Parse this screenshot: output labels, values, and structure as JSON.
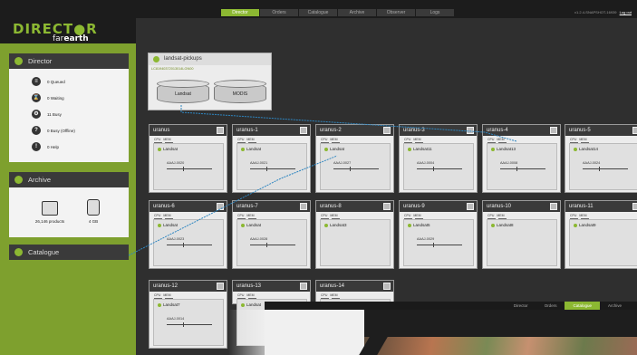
{
  "topnav": {
    "tabs": [
      {
        "label": "Director",
        "active": true
      },
      {
        "label": "Orders",
        "active": false
      },
      {
        "label": "Catalogue",
        "active": false
      },
      {
        "label": "Archive",
        "active": false
      },
      {
        "label": "Observer",
        "active": false
      },
      {
        "label": "Logs",
        "active": false
      }
    ],
    "version": "v1.2.4-SNAPSHOT-16939",
    "logout": "Log out"
  },
  "logo": {
    "title": "DIRECT●R",
    "sub_prefix": "far",
    "sub_bold": "earth"
  },
  "sidebar": {
    "director": {
      "title": "Director",
      "stats": [
        {
          "icon": "queued-icon",
          "glyph": "≡",
          "label": "0 Queued"
        },
        {
          "icon": "waiting-icon",
          "glyph": "⌛",
          "label": "0 Waiting"
        },
        {
          "icon": "busy-icon",
          "glyph": "⚙",
          "label": "11 Busy"
        },
        {
          "icon": "busy-offline-icon",
          "glyph": "?",
          "label": "0 Busy (Offline)"
        },
        {
          "icon": "help-icon",
          "glyph": "!",
          "label": "0 Help"
        }
      ]
    },
    "archive": {
      "title": "Archive",
      "items": [
        {
          "icon": "products-icon",
          "label": "26,146 products"
        },
        {
          "icon": "storage-icon",
          "label": "4 GB"
        }
      ]
    },
    "catalogue": {
      "title": "Catalogue"
    }
  },
  "pickups": {
    "title": "landsat-pickups",
    "path": "LC81940372013014LGN00",
    "stores": [
      "Landsat",
      "MODIS"
    ]
  },
  "hosts": [
    {
      "name": "uranus",
      "job": "Landsat",
      "task": "AAAJ-0020",
      "cpu": "CPU",
      "mem": "MEM"
    },
    {
      "name": "uranus-1",
      "job": "Landsat",
      "task": "AAAJ-0021",
      "cpu": "CPU",
      "mem": "MEM"
    },
    {
      "name": "uranus-2",
      "job": "Landsat",
      "task": "AAAJ-0027",
      "cpu": "CPU",
      "mem": "MEM"
    },
    {
      "name": "uranus-3",
      "job": "Landsat11",
      "task": "AAAJ-0004",
      "cpu": "CPU",
      "mem": "MEM"
    },
    {
      "name": "uranus-4",
      "job": "Landsat13",
      "task": "AAAJ-0008",
      "cpu": "CPU",
      "mem": "MEM"
    },
    {
      "name": "uranus-5",
      "job": "Landsat14",
      "task": "AAAJ-0024",
      "cpu": "CPU",
      "mem": "MEM"
    },
    {
      "name": "uranus-6",
      "job": "Landsat",
      "task": "AAAJ-0023",
      "cpu": "CPU",
      "mem": "MEM"
    },
    {
      "name": "uranus-7",
      "job": "Landsat",
      "task": "AAAJ-0028",
      "cpu": "CPU",
      "mem": "MEM"
    },
    {
      "name": "uranus-8",
      "job": "Landsat3",
      "task": "",
      "cpu": "CPU",
      "mem": "MEM"
    },
    {
      "name": "uranus-9",
      "job": "Landsat5",
      "task": "AAAJ-0029",
      "cpu": "CPU",
      "mem": "MEM"
    },
    {
      "name": "uranus-10",
      "job": "Landsat8",
      "task": "",
      "cpu": "CPU",
      "mem": "MEM"
    },
    {
      "name": "uranus-11",
      "job": "Landsat9",
      "task": "",
      "cpu": "CPU",
      "mem": "MEM"
    },
    {
      "name": "uranus-12",
      "job": "Landsat7",
      "task": "AAAJ-0014",
      "cpu": "CPU",
      "mem": "MEM"
    },
    {
      "name": "uranus-13",
      "job": "Landsat",
      "task": "",
      "cpu": "CPU",
      "mem": "MEM"
    },
    {
      "name": "uranus-14",
      "job": "Landsat",
      "task": "",
      "cpu": "CPU",
      "mem": "MEM"
    }
  ],
  "overlay_nav": [
    {
      "label": "Director",
      "active": false
    },
    {
      "label": "Orders",
      "active": false
    },
    {
      "label": "Catalogue",
      "active": true
    },
    {
      "label": "Archive",
      "active": false
    }
  ]
}
